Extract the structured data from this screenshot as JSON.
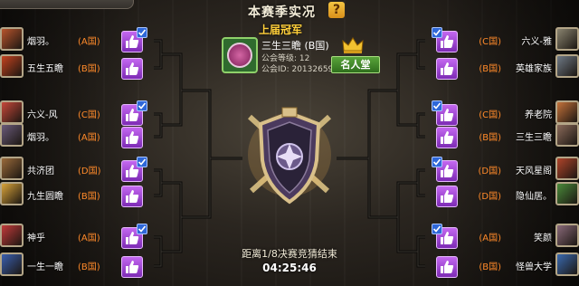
{
  "header": {
    "title": "本赛季实况",
    "help_glyph": "?"
  },
  "champion": {
    "label": "上届冠军",
    "name": "三生三瞻 (B国)",
    "level_text": "公会等级: 12",
    "id_text": "公会ID: 20132659",
    "hall_button": "名人堂"
  },
  "left_teams": [
    {
      "name": "烟羽。",
      "group": "(A国)",
      "avatar_color": "#b8542c",
      "checked": true
    },
    {
      "name": "五生五瞻",
      "group": "(B国)",
      "avatar_color": "#c4421f",
      "checked": false
    },
    {
      "name": "六义-风",
      "group": "(C国)",
      "avatar_color": "#c7483a",
      "checked": true
    },
    {
      "name": "烟羽。",
      "group": "(A国)",
      "avatar_color": "#6a5a7a",
      "checked": false
    },
    {
      "name": "共济团",
      "group": "(D国)",
      "avatar_color": "#9a6a3a",
      "checked": true
    },
    {
      "name": "九生圆瞻",
      "group": "(B国)",
      "avatar_color": "#d9a33a",
      "checked": false
    },
    {
      "name": "神乎",
      "group": "(A国)",
      "avatar_color": "#c23a3a",
      "checked": true
    },
    {
      "name": "一生一瞻",
      "group": "(B国)",
      "avatar_color": "#3a5fb0",
      "checked": false
    }
  ],
  "right_teams": [
    {
      "name": "六义-雅",
      "group": "(C国)",
      "avatar_color": "#8a8470",
      "checked": true
    },
    {
      "name": "英雄家族",
      "group": "(B国)",
      "avatar_color": "#6f7a86",
      "checked": false
    },
    {
      "name": "养老院",
      "group": "(C国)",
      "avatar_color": "#c4723a",
      "checked": true
    },
    {
      "name": "三生三瞻",
      "group": "(B国)",
      "avatar_color": "#8a6a5a",
      "checked": false
    },
    {
      "name": "天风星阁",
      "group": "(D国)",
      "avatar_color": "#b0442a",
      "checked": true
    },
    {
      "name": "隐仙居。",
      "group": "(D国)",
      "avatar_color": "#4a8a3a",
      "checked": false
    },
    {
      "name": "笑颜",
      "group": "(A国)",
      "avatar_color": "#8a6a7a",
      "checked": true
    },
    {
      "name": "怪兽大学",
      "group": "(B国)",
      "avatar_color": "#3a6ab0",
      "checked": false
    }
  ],
  "countdown": {
    "label": "距离1/8决赛竞猜结束",
    "time": "04:25:46"
  },
  "colors": {
    "group_tag": "#ff8a2a",
    "bracket_line": "#0b0a09",
    "like_button": "#9b45d6"
  },
  "icons": {
    "like": "thumbs-up-icon",
    "check": "check-icon",
    "crown": "crown-icon",
    "trophy": "trophy-shield-icon",
    "help": "question-icon"
  }
}
